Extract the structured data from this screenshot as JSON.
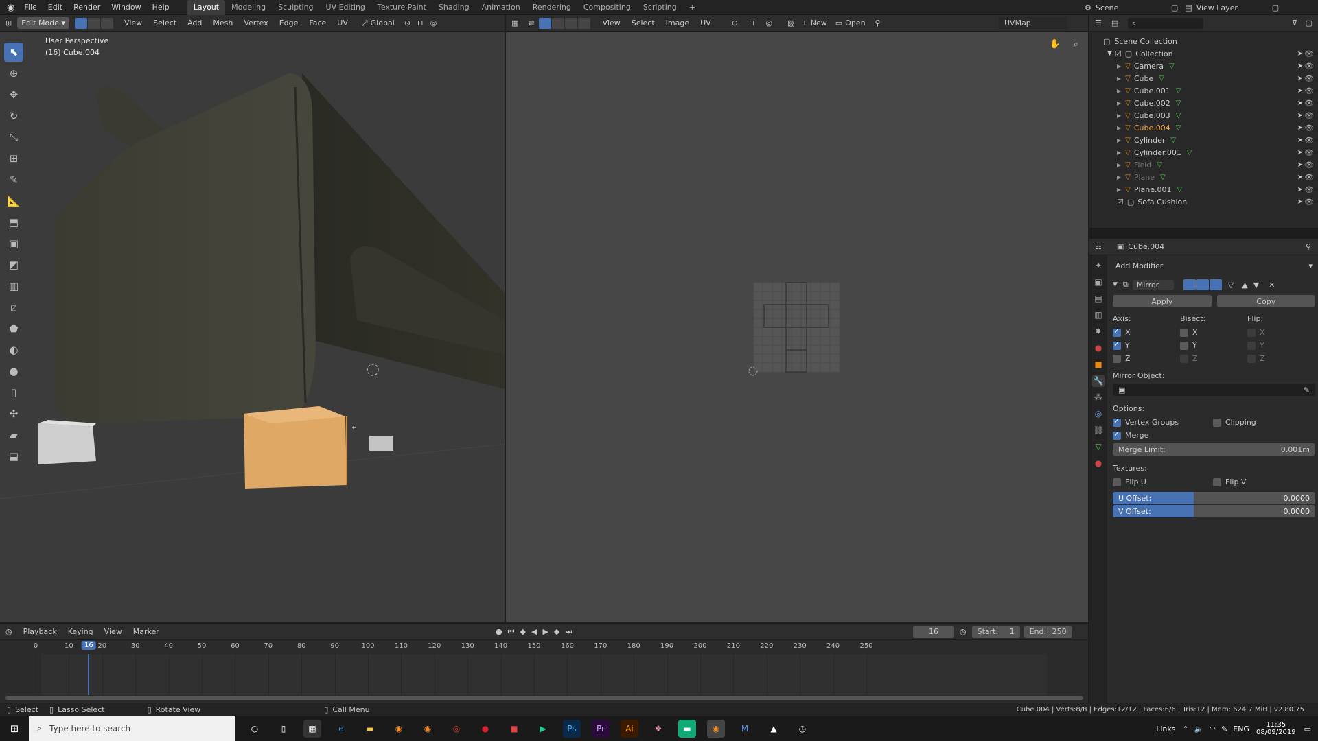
{
  "topbar": {
    "menus": [
      "File",
      "Edit",
      "Render",
      "Window",
      "Help"
    ],
    "workspaces": [
      "Layout",
      "Modeling",
      "Sculpting",
      "UV Editing",
      "Texture Paint",
      "Shading",
      "Animation",
      "Rendering",
      "Compositing",
      "Scripting"
    ],
    "add_ws": "+",
    "scene": "Scene",
    "view_layer": "View Layer"
  },
  "viewport3d": {
    "mode": "Edit Mode",
    "menus": [
      "View",
      "Select",
      "Add",
      "Mesh",
      "Vertex",
      "Edge",
      "Face",
      "UV"
    ],
    "orientation": "Global",
    "overlay_title": "User Perspective",
    "overlay_object": "(16) Cube.004"
  },
  "uv_editor": {
    "menus": [
      "View",
      "Select",
      "Image",
      "UV"
    ],
    "new_label": "New",
    "open_label": "Open",
    "uvmap": "UVMap"
  },
  "outliner": {
    "root": "Scene Collection",
    "collection": "Collection",
    "items": [
      {
        "name": "Camera",
        "state": "normal"
      },
      {
        "name": "Cube",
        "state": "normal"
      },
      {
        "name": "Cube.001",
        "state": "normal"
      },
      {
        "name": "Cube.002",
        "state": "normal"
      },
      {
        "name": "Cube.003",
        "state": "normal"
      },
      {
        "name": "Cube.004",
        "state": "selected"
      },
      {
        "name": "Cylinder",
        "state": "normal"
      },
      {
        "name": "Cylinder.001",
        "state": "normal"
      },
      {
        "name": "Field",
        "state": "dim"
      },
      {
        "name": "Plane",
        "state": "dim"
      },
      {
        "name": "Plane.001",
        "state": "normal"
      }
    ],
    "collection2": "Sofa Cushion"
  },
  "properties": {
    "object": "Cube.004",
    "add_modifier": "Add Modifier",
    "modifier_name": "Mirror",
    "apply": "Apply",
    "copy": "Copy",
    "axis_label": "Axis:",
    "bisect_label": "Bisect:",
    "flip_label": "Flip:",
    "axes": [
      "X",
      "Y",
      "Z"
    ],
    "mirror_object": "Mirror Object:",
    "options": "Options:",
    "vertex_groups": "Vertex Groups",
    "clipping": "Clipping",
    "merge": "Merge",
    "merge_limit_label": "Merge Limit:",
    "merge_limit": "0.001m",
    "textures": "Textures:",
    "flip_u": "Flip U",
    "flip_v": "Flip V",
    "u_offset_label": "U Offset:",
    "u_offset": "0.0000",
    "v_offset_label": "V Offset:",
    "v_offset": "0.0000"
  },
  "timeline": {
    "menus": [
      "Playback",
      "Keying",
      "View",
      "Marker"
    ],
    "current_frame": "16",
    "start_label": "Start:",
    "start": "1",
    "end_label": "End:",
    "end": "250",
    "ticks": [
      "0",
      "10",
      "20",
      "30",
      "40",
      "50",
      "60",
      "70",
      "80",
      "90",
      "100",
      "110",
      "120",
      "130",
      "140",
      "150",
      "160",
      "170",
      "180",
      "190",
      "200",
      "210",
      "220",
      "230",
      "240",
      "250"
    ]
  },
  "status": {
    "select": "Select",
    "lasso": "Lasso Select",
    "rotate": "Rotate View",
    "call_menu": "Call Menu",
    "stats": "Cube.004 | Verts:8/8 | Edges:12/12 | Faces:6/6 | Tris:12 | Mem: 624.7 MiB | v2.80.75"
  },
  "taskbar": {
    "search_placeholder": "Type here to search",
    "links": "Links",
    "lang": "ENG",
    "time": "11:35",
    "date": "08/09/2019"
  },
  "colors": {
    "accent": "#4772b3",
    "selected": "#f0a040",
    "object": "#e8891d"
  }
}
